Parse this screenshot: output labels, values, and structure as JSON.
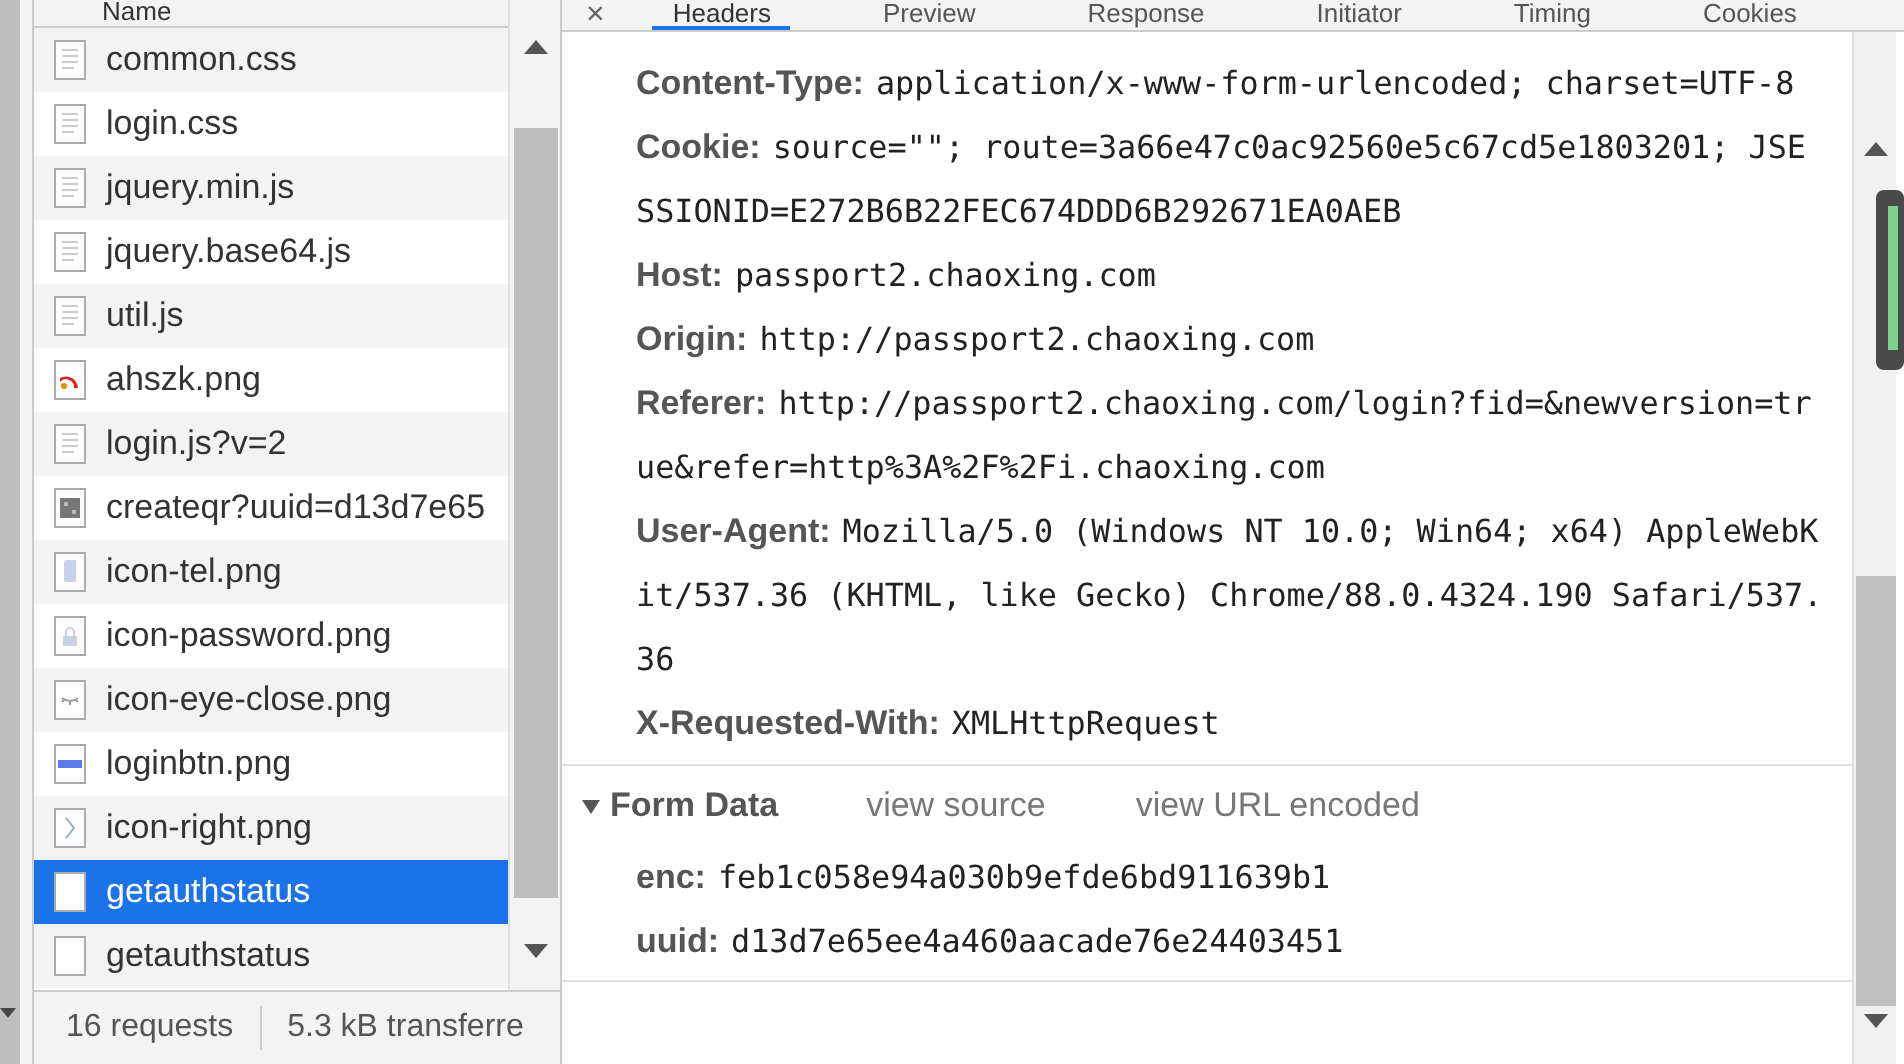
{
  "file_list": {
    "header": "Name",
    "rows": [
      {
        "name": "common.css",
        "kind": "doc",
        "selected": false
      },
      {
        "name": "login.css",
        "kind": "doc",
        "selected": false
      },
      {
        "name": "jquery.min.js",
        "kind": "doc",
        "selected": false
      },
      {
        "name": "jquery.base64.js",
        "kind": "doc",
        "selected": false
      },
      {
        "name": "util.js",
        "kind": "doc",
        "selected": false
      },
      {
        "name": "ahszk.png",
        "kind": "logo",
        "selected": false
      },
      {
        "name": "login.js?v=2",
        "kind": "doc",
        "selected": false
      },
      {
        "name": "createqr?uuid=d13d7e65",
        "kind": "qr",
        "selected": false
      },
      {
        "name": "icon-tel.png",
        "kind": "phone",
        "selected": false
      },
      {
        "name": "icon-password.png",
        "kind": "lock",
        "selected": false
      },
      {
        "name": "icon-eye-close.png",
        "kind": "eye",
        "selected": false
      },
      {
        "name": "loginbtn.png",
        "kind": "bar",
        "selected": false
      },
      {
        "name": "icon-right.png",
        "kind": "chevron",
        "selected": false
      },
      {
        "name": "getauthstatus",
        "kind": "blank",
        "selected": true
      },
      {
        "name": "getauthstatus",
        "kind": "blank",
        "selected": false
      }
    ]
  },
  "status_bar": [
    "16 requests",
    "5.3 kB transferre"
  ],
  "detail": {
    "close": "×",
    "tabs": [
      {
        "label": "Headers",
        "selected": true
      },
      {
        "label": "Preview",
        "selected": false
      },
      {
        "label": "Response",
        "selected": false
      },
      {
        "label": "Initiator",
        "selected": false
      },
      {
        "label": "Timing",
        "selected": false
      },
      {
        "label": "Cookies",
        "selected": false
      }
    ],
    "request_headers": [
      {
        "key": "Content-Type:",
        "value": "application/x-www-form-urlencoded; charset=UTF-8"
      },
      {
        "key": "Cookie:",
        "value": "source=\"\"; route=3a66e47c0ac92560e5c67cd5e1803201; JSESSIONID=E272B6B22FEC674DDD6B292671EA0AEB"
      },
      {
        "key": "Host:",
        "value": "passport2.chaoxing.com"
      },
      {
        "key": "Origin:",
        "value": "http://passport2.chaoxing.com"
      },
      {
        "key": "Referer:",
        "value": "http://passport2.chaoxing.com/login?fid=&newversion=true&refer=http%3A%2F%2Fi.chaoxing.com"
      },
      {
        "key": "User-Agent:",
        "value": "Mozilla/5.0 (Windows NT 10.0; Win64; x64) AppleWebKit/537.36 (KHTML, like Gecko) Chrome/88.0.4324.190 Safari/537.36"
      },
      {
        "key": "X-Requested-With:",
        "value": "XMLHttpRequest"
      }
    ],
    "form_data": {
      "title": "Form Data",
      "expanded": true,
      "links": [
        "view source",
        "view URL encoded"
      ],
      "fields": [
        {
          "key": "enc:",
          "value": "feb1c058e94a030b9efde6bd911639b1"
        },
        {
          "key": "uuid:",
          "value": "d13d7e65ee4a460aacade76e24403451"
        }
      ]
    }
  }
}
